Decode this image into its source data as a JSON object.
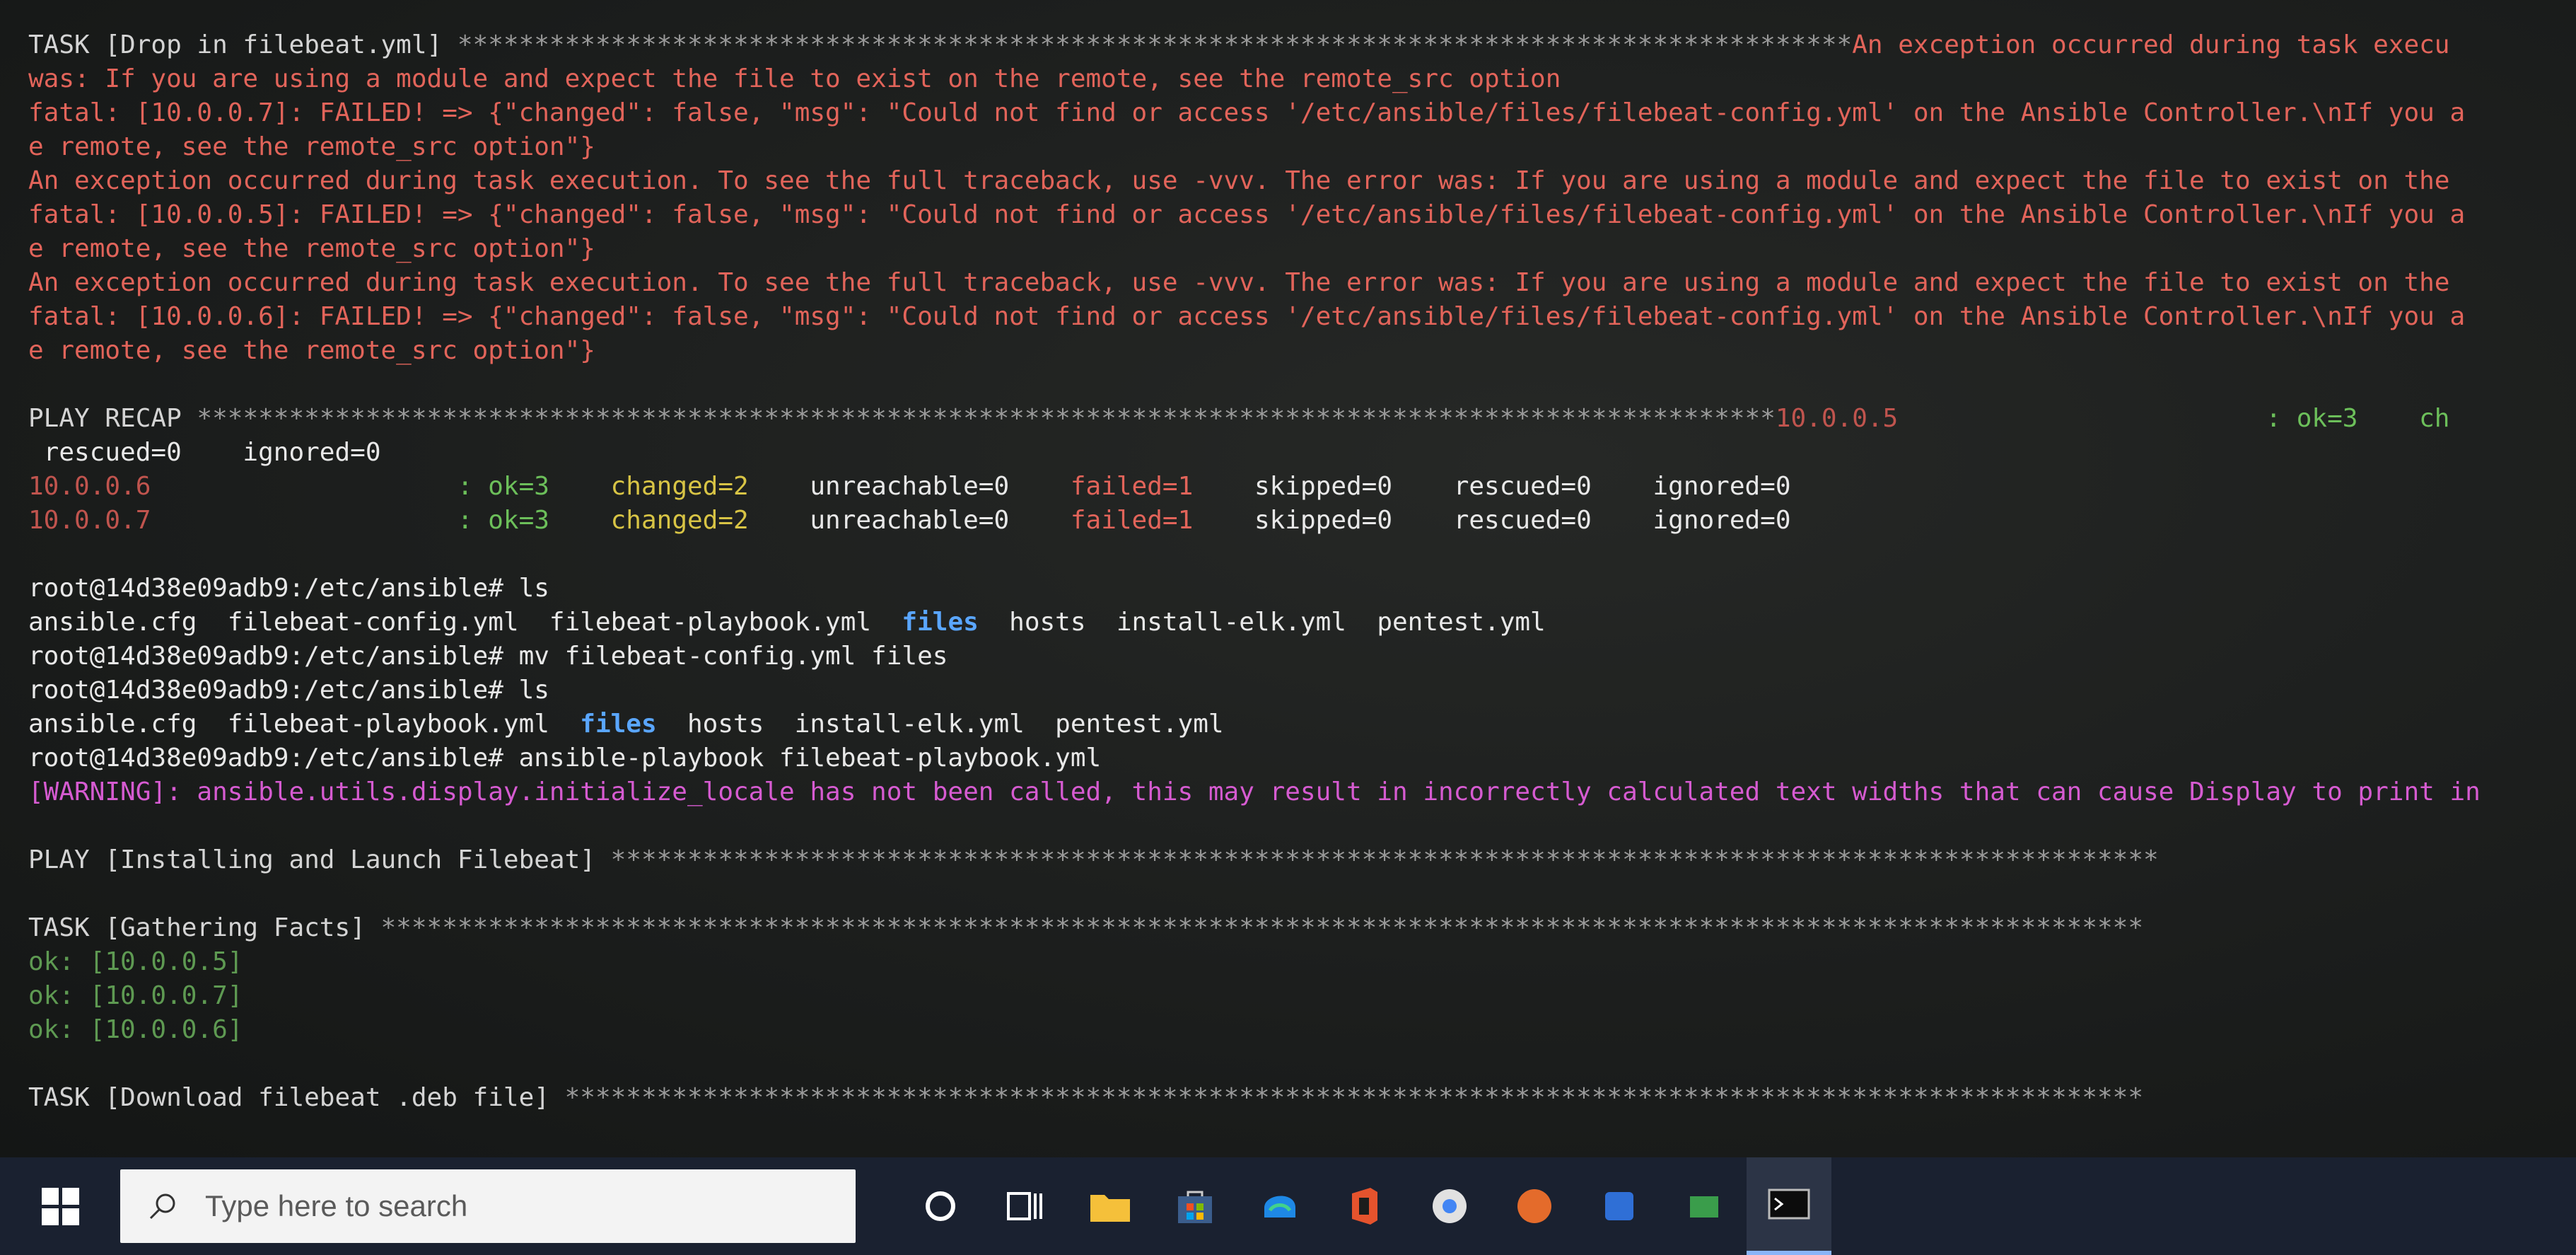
{
  "terminal": {
    "lines": [
      [
        {
          "t": "TASK [Drop in filebeat.yml] ",
          "c": "hdr"
        },
        {
          "t": "*******************************************************************************************",
          "c": "gray"
        },
        {
          "t": "An exception occurred during task execu",
          "c": "red"
        }
      ],
      [
        {
          "t": "was: If you are using a module and expect the file to exist on the remote, see the remote_src option",
          "c": "red"
        }
      ],
      [
        {
          "t": "fatal: [10.0.0.7]: FAILED! => {\"changed\": false, \"msg\": \"Could not find or access '/etc/ansible/files/filebeat-config.yml' on the Ansible Controller.\\nIf you a",
          "c": "red"
        }
      ],
      [
        {
          "t": "e remote, see the remote_src option\"}",
          "c": "red"
        }
      ],
      [
        {
          "t": "An exception occurred during task execution. To see the full traceback, use -vvv. The error was: If you are using a module and expect the file to exist on the",
          "c": "red"
        }
      ],
      [
        {
          "t": "fatal: [10.0.0.5]: FAILED! => {\"changed\": false, \"msg\": \"Could not find or access '/etc/ansible/files/filebeat-config.yml' on the Ansible Controller.\\nIf you a",
          "c": "red"
        }
      ],
      [
        {
          "t": "e remote, see the remote_src option\"}",
          "c": "red"
        }
      ],
      [
        {
          "t": "An exception occurred during task execution. To see the full traceback, use -vvv. The error was: If you are using a module and expect the file to exist on the",
          "c": "red"
        }
      ],
      [
        {
          "t": "fatal: [10.0.0.6]: FAILED! => {\"changed\": false, \"msg\": \"Could not find or access '/etc/ansible/files/filebeat-config.yml' on the Ansible Controller.\\nIf you a",
          "c": "red"
        }
      ],
      [
        {
          "t": "e remote, see the remote_src option\"}",
          "c": "red"
        }
      ],
      null,
      [
        {
          "t": "PLAY RECAP ",
          "c": "hdr"
        },
        {
          "t": "*******************************************************************************************************",
          "c": "gray"
        },
        {
          "t": "10.0.0.5",
          "c": "dimred"
        },
        {
          "t": "                        : ok=3    ch",
          "c": "green"
        }
      ],
      [
        {
          "t": " rescued=0    ignored=0",
          "c": "white"
        }
      ],
      [
        {
          "t": "10.0.0.6",
          "c": "dimred"
        },
        {
          "t": "                    : ok=3",
          "c": "green"
        },
        {
          "t": "    changed=2",
          "c": "yellow"
        },
        {
          "t": "    unreachable=0",
          "c": "white"
        },
        {
          "t": "    failed=1",
          "c": "red"
        },
        {
          "t": "    skipped=0    rescued=0    ignored=0",
          "c": "white"
        }
      ],
      [
        {
          "t": "10.0.0.7",
          "c": "dimred"
        },
        {
          "t": "                    : ok=3",
          "c": "green"
        },
        {
          "t": "    changed=2",
          "c": "yellow"
        },
        {
          "t": "    unreachable=0",
          "c": "white"
        },
        {
          "t": "    failed=1",
          "c": "red"
        },
        {
          "t": "    skipped=0    rescued=0    ignored=0",
          "c": "white"
        }
      ],
      null,
      [
        {
          "t": "root@14d38e09adb9:/etc/ansible# ls",
          "c": "white"
        }
      ],
      [
        {
          "t": "ansible.cfg  filebeat-config.yml  filebeat-playbook.yml  ",
          "c": "white"
        },
        {
          "t": "files",
          "c": "blue"
        },
        {
          "t": "  hosts  install-elk.yml  pentest.yml",
          "c": "white"
        }
      ],
      [
        {
          "t": "root@14d38e09adb9:/etc/ansible# mv filebeat-config.yml files",
          "c": "white"
        }
      ],
      [
        {
          "t": "root@14d38e09adb9:/etc/ansible# ls",
          "c": "white"
        }
      ],
      [
        {
          "t": "ansible.cfg  filebeat-playbook.yml  ",
          "c": "white"
        },
        {
          "t": "files",
          "c": "blue"
        },
        {
          "t": "  hosts  install-elk.yml  pentest.yml",
          "c": "white"
        }
      ],
      [
        {
          "t": "root@14d38e09adb9:/etc/ansible# ansible-playbook filebeat-playbook.yml",
          "c": "white"
        }
      ],
      [
        {
          "t": "[WARNING]: ansible.utils.display.initialize_locale has not been called, this may result in incorrectly calculated text widths that can cause Display to print in",
          "c": "pink"
        }
      ],
      null,
      [
        {
          "t": "PLAY [Installing and Launch Filebeat] ",
          "c": "hdr"
        },
        {
          "t": "*****************************************************************************************************",
          "c": "gray"
        }
      ],
      null,
      [
        {
          "t": "TASK [Gathering Facts] ",
          "c": "hdr"
        },
        {
          "t": "*******************************************************************************************************************",
          "c": "gray"
        }
      ],
      [
        {
          "t": "ok: [10.0.0.5]",
          "c": "dimgreen"
        }
      ],
      [
        {
          "t": "ok: [10.0.0.7]",
          "c": "dimgreen"
        }
      ],
      [
        {
          "t": "ok: [10.0.0.6]",
          "c": "dimgreen"
        }
      ],
      null,
      [
        {
          "t": "TASK [Download filebeat .deb file] ",
          "c": "hdr"
        },
        {
          "t": "*******************************************************************************************************",
          "c": "gray"
        }
      ]
    ]
  },
  "taskbar": {
    "search_placeholder": "Type here to search",
    "icons": [
      "search-circle-icon",
      "task-view-icon",
      "file-explorer-icon",
      "store-icon",
      "edge-icon",
      "office-icon",
      "chrome-icon",
      "app-icon",
      "terminal-icon"
    ]
  },
  "colors": {
    "error": "#e2645a",
    "ok": "#6cbf5a",
    "changed": "#d8c445",
    "warning": "#d65bd1",
    "directory": "#5aa6ff",
    "taskbar": "#1a2130"
  }
}
